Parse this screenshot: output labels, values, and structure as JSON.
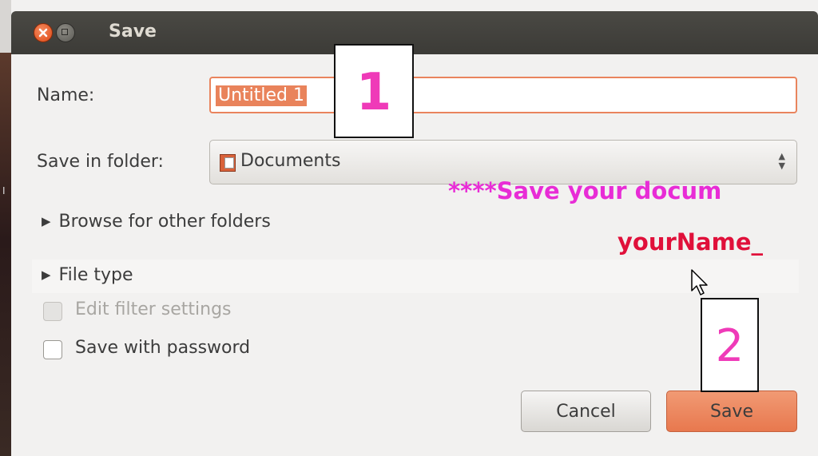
{
  "window": {
    "title": "Save"
  },
  "form": {
    "name_label": "Name:",
    "name_value": "Untitled 1",
    "folder_label": "Save in folder:",
    "folder_value": "Documents",
    "browse_label": "Browse for other folders",
    "file_type_label": "File type",
    "edit_filter_label": "Edit filter settings",
    "save_with_password_label": "Save with password"
  },
  "buttons": {
    "cancel": "Cancel",
    "save": "Save"
  },
  "callouts": {
    "step1": "1",
    "step2": "2"
  },
  "overlay": {
    "line1": "****Save your docum",
    "line2": "yourName_"
  },
  "colors": {
    "accent": "#e9845d",
    "callout_text": "#ef3ab8",
    "overlay_line1": "#e82cd6",
    "overlay_line2": "#e0103a",
    "titlebar": "#3c3b37"
  }
}
